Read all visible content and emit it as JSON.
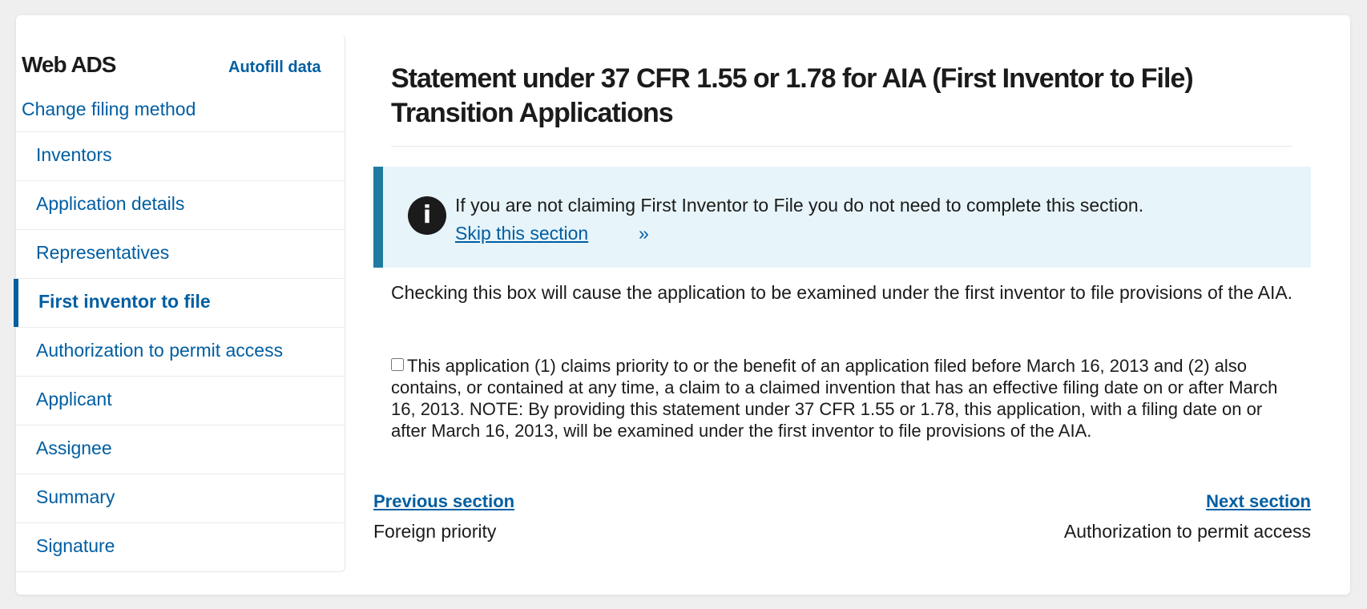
{
  "sidebar": {
    "brand": "Web ADS",
    "autofill_label": "Autofill data",
    "change_method_label": "Change filing method",
    "items": [
      {
        "label": "Inventors",
        "active": false
      },
      {
        "label": "Application details",
        "active": false
      },
      {
        "label": "Representatives",
        "active": false
      },
      {
        "label": "First inventor to file",
        "active": true
      },
      {
        "label": "Authorization to permit access",
        "active": false
      },
      {
        "label": "Applicant",
        "active": false
      },
      {
        "label": "Assignee",
        "active": false
      },
      {
        "label": "Summary",
        "active": false
      },
      {
        "label": "Signature",
        "active": false
      }
    ]
  },
  "main": {
    "title": "Statement under 37 CFR 1.55 or 1.78 for AIA (First Inventor to File) Transition Applications",
    "alert": {
      "icon": "info-icon",
      "text": "If you are not claiming First Inventor to File you do not need to complete this section.",
      "skip_label": " Skip this section ",
      "skip_arrow": "»"
    },
    "intro": "Checking this box will cause the application to be examined under the first inventor to file provisions of the AIA.",
    "checkbox": {
      "checked": false,
      "label": "This application (1) claims priority to or the benefit of an application filed before March 16, 2013 and (2) also contains, or contained at any time, a claim to a claimed invention that has an effective filing date on or after March 16, 2013. NOTE: By providing this statement under 37 CFR 1.55 or 1.78, this application, with a filing date on or after March 16, 2013, will be examined under the first inventor to file provisions of the AIA."
    },
    "navigation": {
      "prev_label": "Previous section",
      "prev_desc": "Foreign priority",
      "next_label": "Next section",
      "next_desc": "Authorization to permit access"
    }
  },
  "colors": {
    "link": "#005ea2",
    "alert_bg": "#e7f4f9",
    "alert_border": "#1f7aa0",
    "text": "#1b1b1b"
  }
}
